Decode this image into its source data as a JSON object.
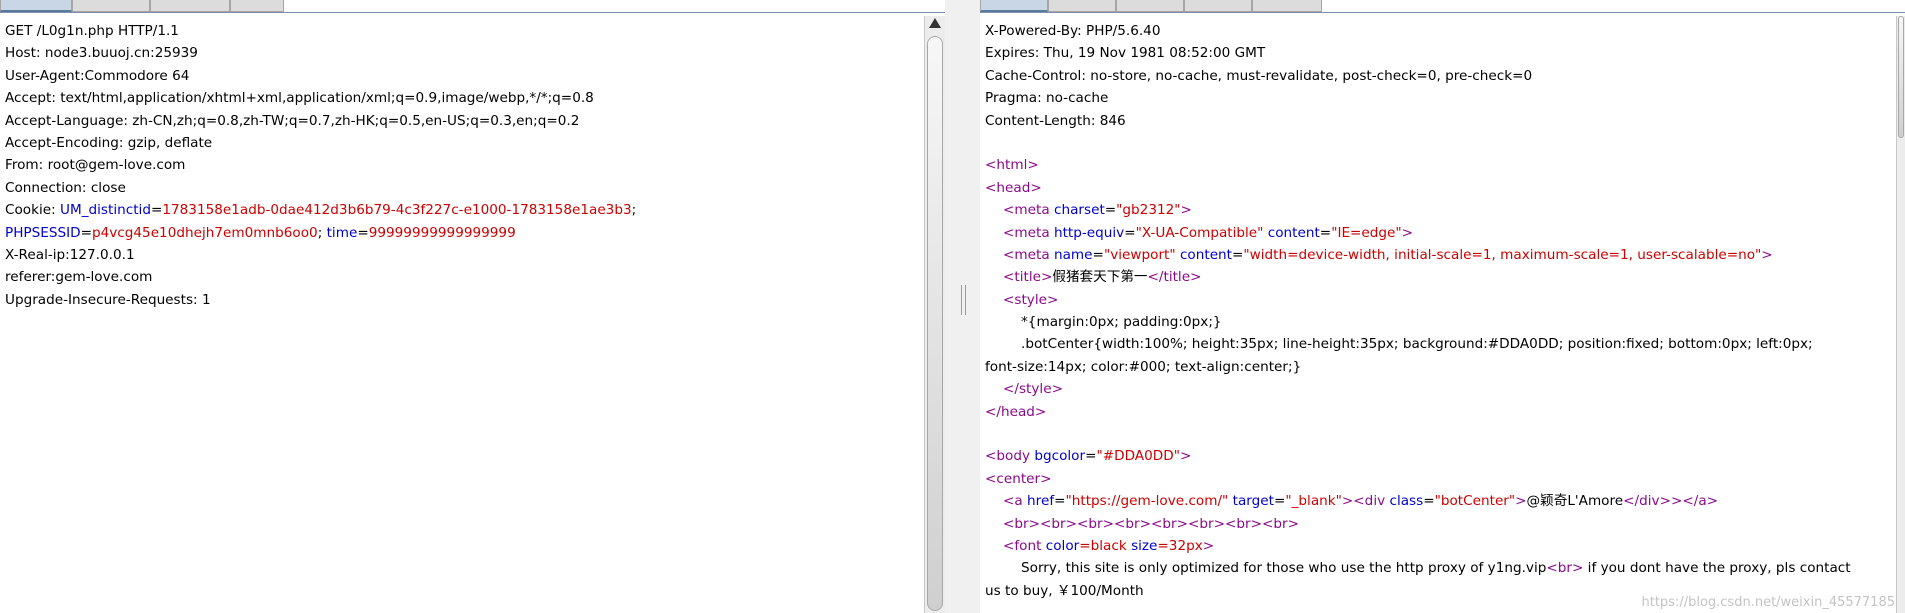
{
  "request": {
    "lines": [
      "GET /L0g1n.php HTTP/1.1",
      "Host: node3.buuoj.cn:25939",
      "User-Agent:Commodore 64",
      "Accept: text/html,application/xhtml+xml,application/xml;q=0.9,image/webp,*/*;q=0.8",
      "Accept-Language: zh-CN,zh;q=0.8,zh-TW;q=0.7,zh-HK;q=0.5,en-US;q=0.3,en;q=0.2",
      "Accept-Encoding: gzip, deflate",
      "From: root@gem-love.com",
      "Connection: close"
    ],
    "cookie": {
      "prefix": "Cookie: ",
      "um_key": "UM_distinctid",
      "um_value": "1783158e1adb-0dae412d3b6b79-4c3f227c-e1000-1783158e1ae3b3",
      "phpsessid_key": "PHPSESSID",
      "phpsessid_value": "p4vcg45e10dhejh7em0mnb6oo0",
      "time_key": "time",
      "time_value": "99999999999999999"
    },
    "lines_after": [
      "X-Real-ip:127.0.0.1",
      "referer:gem-love.com",
      "Upgrade-Insecure-Requests: 1"
    ]
  },
  "response": {
    "headers": [
      "X-Powered-By: PHP/5.6.40",
      "Expires: Thu, 19 Nov 1981 08:52:00 GMT",
      "Cache-Control: no-store, no-cache, must-revalidate, post-check=0, pre-check=0",
      "Pragma: no-cache",
      "Content-Length: 846"
    ],
    "html": {
      "html_open": "<html>",
      "head_open": "<head>",
      "meta1": {
        "open": "<meta ",
        "attr": "charset",
        "value": "\"gb2312\"",
        "close": ">"
      },
      "meta2": {
        "open": "<meta ",
        "attr1": "http-equiv",
        "value1": "\"X-UA-Compatible\"",
        "attr2": "content",
        "value2": "\"IE=edge\"",
        "close": ">"
      },
      "meta3": {
        "open": "<meta ",
        "attr1": "name",
        "value1": "\"viewport\"",
        "attr2": "content",
        "value2": "\"width=device-width, initial-scale=1, maximum-scale=1, user-scalable=no\"",
        "close": ">"
      },
      "title": {
        "open": "<title>",
        "text": "假猪套天下第一",
        "close": "</title>"
      },
      "style_open": "<style>",
      "css1": "*{margin:0px; padding:0px;}",
      "css2": ".botCenter{width:100%; height:35px; line-height:35px; background:#DDA0DD; position:fixed; bottom:0px; left:0px;",
      "css3": "font-size:14px; color:#000; text-align:center;}",
      "style_close": "</style>",
      "head_close": "</head>",
      "body": {
        "open": "<body ",
        "attr": "bgcolor",
        "value": "\"#DDA0DD\"",
        "close": ">"
      },
      "center_open": "<center>",
      "anchor": {
        "open": "<a ",
        "attr1": "href",
        "value1": "\"https://gem-love.com/\"",
        "attr2": "target",
        "value2": "\"_blank\"",
        "mid": "><div ",
        "attr3": "class",
        "value3": "\"botCenter\"",
        "gt": ">",
        "text": "@颖奇L'Amore",
        "div_close": "</div>",
        "a_close": "></a>"
      },
      "br_line": "<br><br><br><br><br><br><br><br>",
      "font": {
        "open": "<font ",
        "attr1": "color",
        "value1": "=black",
        "attr2": "size",
        "value2": "=32px",
        "close": ">"
      },
      "sorry_pre": "Sorry, this site is only optimized for those who use the http proxy of y1ng.vip",
      "sorry_br": "<br>",
      "sorry_post": " if you dont have the proxy, pls contact us to buy, ￥100/Month"
    }
  },
  "watermark": "https://blog.csdn.net/weixin_45577185"
}
